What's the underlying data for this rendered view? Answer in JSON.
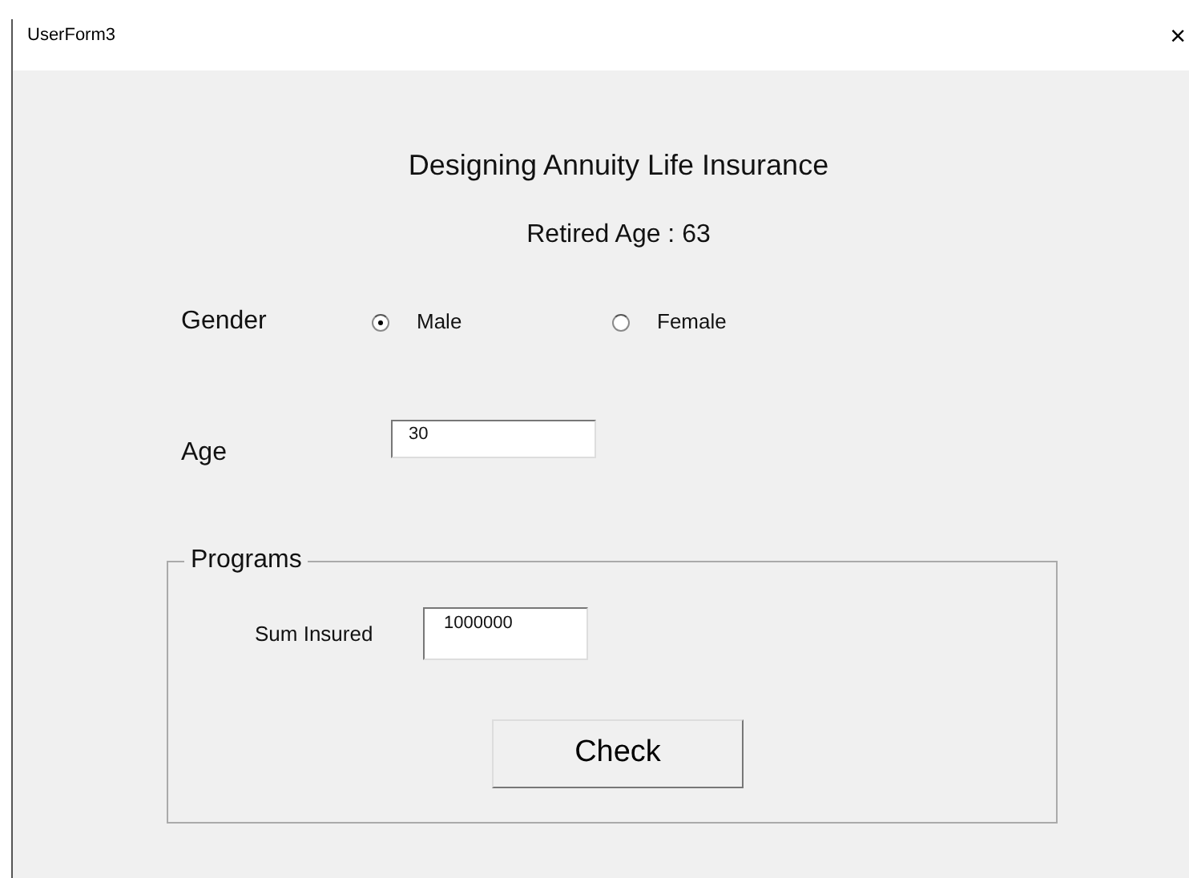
{
  "window": {
    "title": "UserForm3",
    "close": "×"
  },
  "heading": "Designing Annuity Life Insurance",
  "retired_age": "Retired Age : 63",
  "gender": {
    "label": "Gender",
    "options": [
      {
        "label": "Male",
        "selected": true
      },
      {
        "label": "Female",
        "selected": false
      }
    ]
  },
  "age": {
    "label": "Age",
    "value": "30"
  },
  "programs": {
    "title": "Programs",
    "sum_insured": {
      "label": "Sum Insured",
      "value": "1000000"
    },
    "button": "Check"
  }
}
